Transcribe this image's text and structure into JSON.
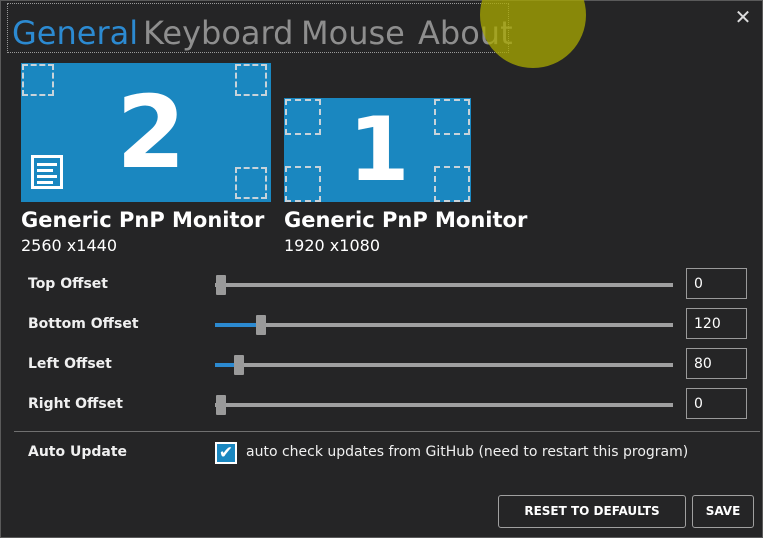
{
  "tabs": [
    {
      "label": "General",
      "active": true
    },
    {
      "label": "Keyboard",
      "active": false
    },
    {
      "label": "Mouse",
      "active": false
    },
    {
      "label": "About",
      "active": false
    }
  ],
  "close_glyph": "✕",
  "monitors": [
    {
      "number": "2",
      "name": "Generic PnP Monitor",
      "resolution": "2560 x1440",
      "icon": "taskbar-icon"
    },
    {
      "number": "1",
      "name": "Generic PnP Monitor",
      "resolution": "1920 x1080"
    }
  ],
  "offsets": [
    {
      "label": "Top Offset",
      "value": "0",
      "slider_fraction": 0.0
    },
    {
      "label": "Bottom Offset",
      "value": "120",
      "slider_fraction": 0.09
    },
    {
      "label": "Left Offset",
      "value": "80",
      "slider_fraction": 0.04
    },
    {
      "label": "Right Offset",
      "value": "0",
      "slider_fraction": 0.0
    }
  ],
  "auto_update": {
    "label": "Auto Update",
    "checked": true,
    "check_glyph": "✔",
    "checkbox_text": "auto check updates from GitHub (need to restart this program)"
  },
  "buttons": {
    "reset": "RESET TO DEFAULTS",
    "save": "SAVE"
  },
  "colors": {
    "accent": "#2c8ad1",
    "monitor": "#1a87c0",
    "background": "#252526",
    "cursor_highlight": "#aaaa00"
  }
}
